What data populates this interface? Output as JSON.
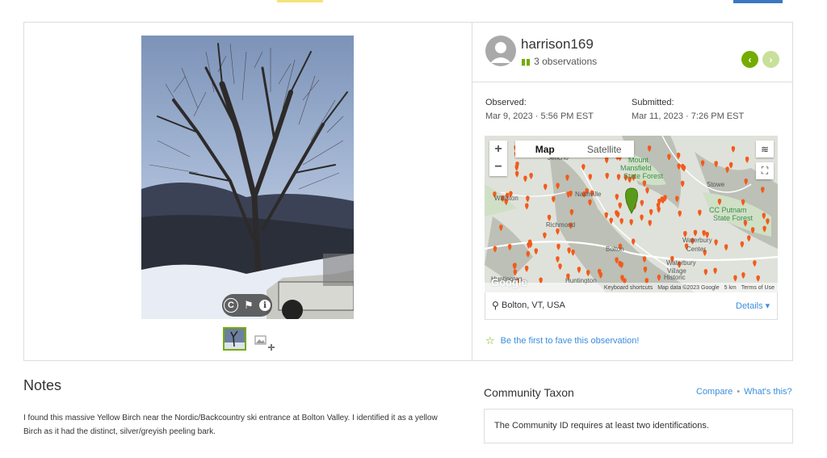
{
  "header": {
    "title_partial": "...",
    "colors": {
      "badge": "#f3e27a",
      "button": "#3b78c2"
    }
  },
  "photo": {
    "controls": [
      "copyright-icon",
      "flag-icon",
      "info-icon"
    ],
    "thumbnail_count": 1
  },
  "observer": {
    "username": "harrison169",
    "observations": "3 observations"
  },
  "observed": {
    "label": "Observed:",
    "value": "Mar 9, 2023 · 5:56 PM EST"
  },
  "submitted": {
    "label": "Submitted:",
    "value": "Mar 11, 2023 · 7:26 PM EST"
  },
  "map": {
    "tabs": [
      "Map",
      "Satellite"
    ],
    "active_tab": "Map",
    "zoom_in": "+",
    "zoom_out": "−",
    "place_labels": [
      "Jericho",
      "Williston",
      "Nashville",
      "Richmond",
      "Bolton",
      "Waterbury",
      "Mount Mansfield State Forest",
      "CC Putnam State Forest",
      "Waterbury Center",
      "Stowe",
      "Huntington",
      "Historic"
    ],
    "footer": [
      "Keyboard shortcuts",
      "Map data ©2023 Google",
      "5 km",
      "Terms of Use"
    ],
    "logo": "Google"
  },
  "location": {
    "text": "Bolton, VT, USA",
    "details": "Details ▾"
  },
  "fave": "Be the first to fave this observation!",
  "notes": {
    "heading": "Notes",
    "body": "I found this massive Yellow Birch near the Nordic/Backcountry ski entrance at Bolton Valley. I identified it as a yellow Birch as it had the distinct, silver/greyish peeling bark."
  },
  "community_taxon": {
    "heading": "Community Taxon",
    "compare": "Compare",
    "whats_this": "What's this?",
    "message": "The Community ID requires at least two identifications."
  },
  "colors": {
    "accent_green": "#74ac00",
    "link_blue": "#3b8edd",
    "pin_orange": "#f25b1c",
    "marker_green": "#5a9a1b"
  }
}
